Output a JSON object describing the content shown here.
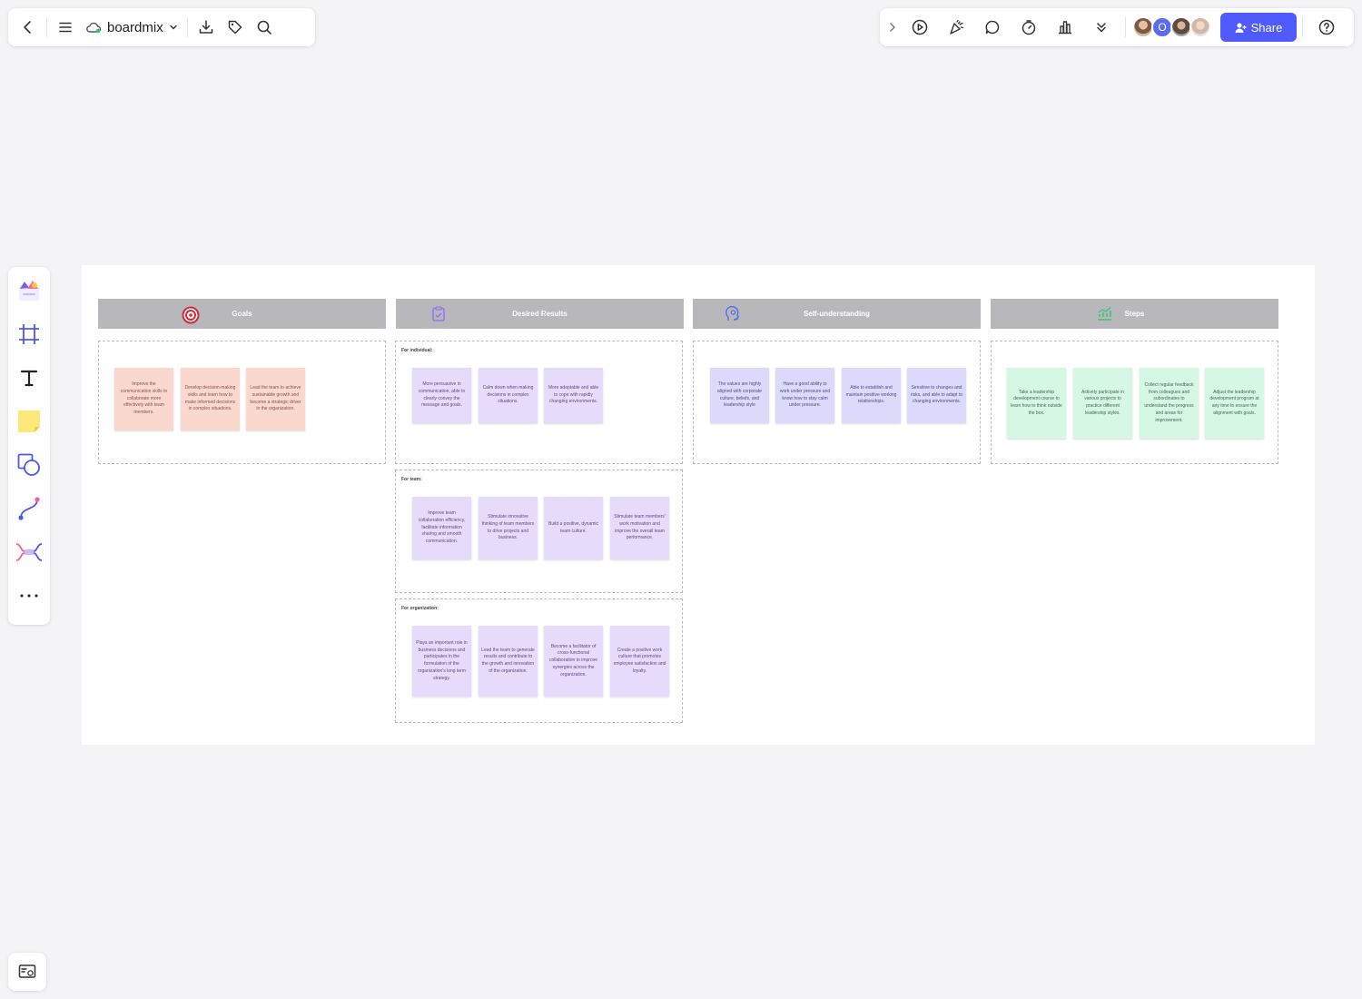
{
  "toolbar_left": {
    "doc_title": "boardmix",
    "icons": [
      "back-icon",
      "menu-icon",
      "cloud-icon",
      "chevron-down-icon",
      "download-icon",
      "tag-icon",
      "search-icon"
    ]
  },
  "toolbar_right": {
    "icons": [
      "chevron-right-icon",
      "play-icon",
      "celebrate-icon",
      "comment-icon",
      "timer-icon",
      "vote-icon",
      "more-down-icon",
      "help-icon"
    ],
    "avatar_letter": "O",
    "share_label": "Share",
    "accent": "#4f5bff"
  },
  "rail": {
    "tools": [
      "templates-icon",
      "frame-icon",
      "text-icon",
      "sticky-note-icon",
      "shape-icon",
      "connector-icon",
      "mindmap-icon",
      "more-icon"
    ]
  },
  "board": {
    "headers": [
      {
        "label": "Goals",
        "icon": "target-icon"
      },
      {
        "label": "Desired Results",
        "icon": "clipboard-icon"
      },
      {
        "label": "Self-understanding",
        "icon": "head-icon"
      },
      {
        "label": "Steps",
        "icon": "chart-up-icon"
      }
    ],
    "goals": [
      "Improve the communication skills to collaborate more effectively with team members.",
      "Develop decision-making skills and learn how to make informed decisions in complex situations.",
      "Lead the team to achieve sustainable growth and become a strategic driver in the organization."
    ],
    "results": {
      "individual_label": "For individual:",
      "individual": [
        "More persuasive in communication, able to clearly convey the message and goals.",
        "Calm down when making decisions in complex situations.",
        "More adaptable and able to cope with rapidly changing environments."
      ],
      "team_label": "For team:",
      "team": [
        "Improve team collaboration efficiency, facilitate information sharing and smooth communication.",
        "Stimulate innovative thinking of team members to drive projects and business.",
        "Build a positive, dynamic team culture.",
        "Stimulate team members' work motivation and improve the overall team performance."
      ],
      "org_label": "For organization:",
      "org": [
        "Plays an important role in business decisions and participates in the formulation of the organization's long term strategy.",
        "Lead the team to generate results and contribute to the growth and innovation of the organization.",
        "Become a facilitator of cross-functional collaboration to improve synergies across the organization.",
        "Create a positive work culture that promotes employee satisfaction and loyalty."
      ]
    },
    "self": [
      "The values are highly aligned with corporate culture, beliefs, and leadership style",
      "Have a good ability to work under pressure and know how to stay calm under pressure.",
      "Able to establish and maintain positive working relationships.",
      "Sensitive to changes and risks, and able to adapt to changing environments."
    ],
    "steps": [
      "Take a leadership development course to learn how to think outside the box.",
      "Actively participate in various projects to practice different leadership styles.",
      "Collect regular feedback from colleagues and subordinates to understand the progress and areas for improvement.",
      "Adjust the leadership development program at any time to ensure the alignment with goals."
    ],
    "colors": {
      "goals_note": "#fbd8cd",
      "results_note": "#e6dbfa",
      "self_note": "#ddd9fb",
      "steps_note": "#d5f7e3",
      "header_bg": "#b8b8bc"
    }
  }
}
